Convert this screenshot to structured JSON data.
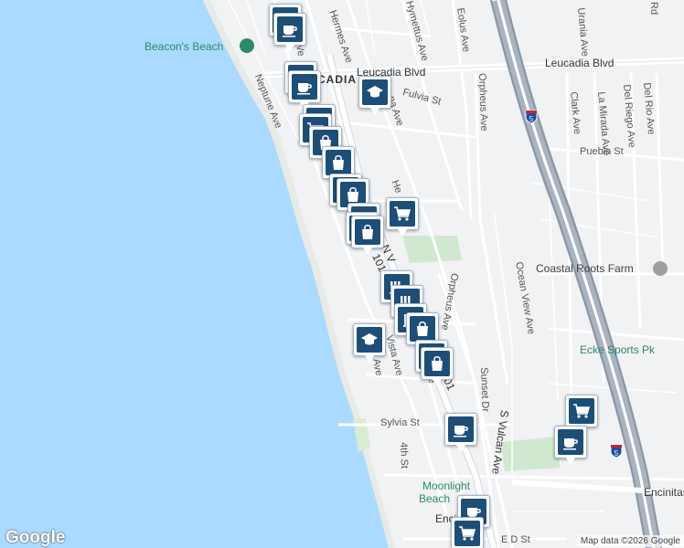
{
  "map": {
    "attribution": "Map data ©2026 Google",
    "logo": "Google",
    "colors": {
      "water": "#aadaff",
      "land": "#f1f2f4",
      "park": "#c8e6c9",
      "freeway": "#a8b4c0",
      "pin": "#1d4e78"
    },
    "roads": {
      "leucadia_blvd_west": "Leucadia Blvd",
      "leucadia_blvd_east": "Leucadia Blvd",
      "neptune": "Neptune Ave",
      "hermes": "Hermes Ave",
      "hymettus": "Hymettus Ave",
      "eolus": "Eolus Ave",
      "fulvia": "Fulvia St",
      "orpheus_n": "Orpheus Ave",
      "orpheus_s": "Orpheus Ave",
      "urania": "Urania Ave",
      "clark": "Clark Ave",
      "la_mirada": "La Mirada Ave",
      "del_riego": "Del Riego Ave",
      "del_rio": "Del Rio Ave",
      "puebla": "Puebla St",
      "ocean_view": "Ocean View Ave",
      "vista": "Vista Ave",
      "melrose": "Melrose Ave",
      "sunset": "Sunset Dr",
      "s_vulcan": "S Vulcan Ave",
      "sylvia": "Sylvia St",
      "fourth": "4th St",
      "e_d": "E D St",
      "encinitas_blvd": "Encinitas Blvd",
      "hwy101_n": "101",
      "hwy101_s": "01",
      "n_vu": "N V",
      "a_ave": "A Ave",
      "he_frag": "He",
      "ve_frag": "Ve",
      "na_ave": "na Ave",
      "rd": "Rd",
      "enc_frag": "Enci",
      "ve": "Ave"
    },
    "places": {
      "beacons_beach": "Beacon's Beach",
      "leucadia": "LEUCADIA",
      "coastal_roots": "Coastal Roots Farm",
      "ecke_sports": "Ecke Sports Pk",
      "moonlight_beach_1": "Moonlight",
      "moonlight_beach_2": "Beach"
    },
    "shields": {
      "i5_top": "5",
      "i5_bottom": "5"
    },
    "markers": [
      {
        "type": "cafe-icon"
      },
      {
        "type": "cafe-icon"
      },
      {
        "type": "library-icon"
      },
      {
        "type": "cafe-icon"
      },
      {
        "type": "school-icon"
      },
      {
        "type": "library-icon"
      },
      {
        "type": "cart-icon"
      },
      {
        "type": "bag-icon"
      },
      {
        "type": "bag-icon"
      },
      {
        "type": "library-icon"
      },
      {
        "type": "bag-icon"
      },
      {
        "type": "cart-icon"
      },
      {
        "type": "bag-icon"
      },
      {
        "type": "bag-icon"
      },
      {
        "type": "bag-icon"
      },
      {
        "type": "library-icon"
      },
      {
        "type": "library-icon"
      },
      {
        "type": "library-icon"
      },
      {
        "type": "bag-icon"
      },
      {
        "type": "school-icon"
      },
      {
        "type": "library-icon"
      },
      {
        "type": "bag-icon"
      },
      {
        "type": "cafe-icon"
      },
      {
        "type": "cart-icon"
      },
      {
        "type": "cafe-icon"
      },
      {
        "type": "cafe-icon"
      },
      {
        "type": "cart-icon"
      }
    ]
  }
}
